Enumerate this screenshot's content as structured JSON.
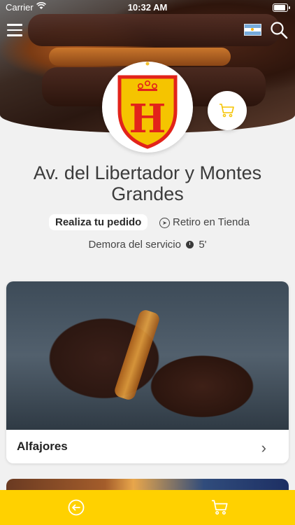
{
  "status_bar": {
    "carrier": "Carrier",
    "time": "10:32 AM"
  },
  "header": {
    "menu_icon": "hamburger-menu-icon",
    "flag_icon": "argentina-flag-icon",
    "search_icon": "search-icon",
    "logo_letter": "H"
  },
  "store": {
    "name": "Av. del Libertador y Montes Grandes",
    "order_button": "Realiza tu pedido",
    "pickup_label": "Retiro en Tienda",
    "delay_label": "Demora del servicio",
    "delay_value": "5'"
  },
  "categories": [
    {
      "label": "Alfajores"
    }
  ],
  "colors": {
    "accent": "#FFD100",
    "brand_red": "#E2231A",
    "brand_yellow": "#FFD100"
  },
  "bottom_bar": {
    "back_icon": "back-arrow-icon",
    "cart_icon": "cart-icon"
  }
}
